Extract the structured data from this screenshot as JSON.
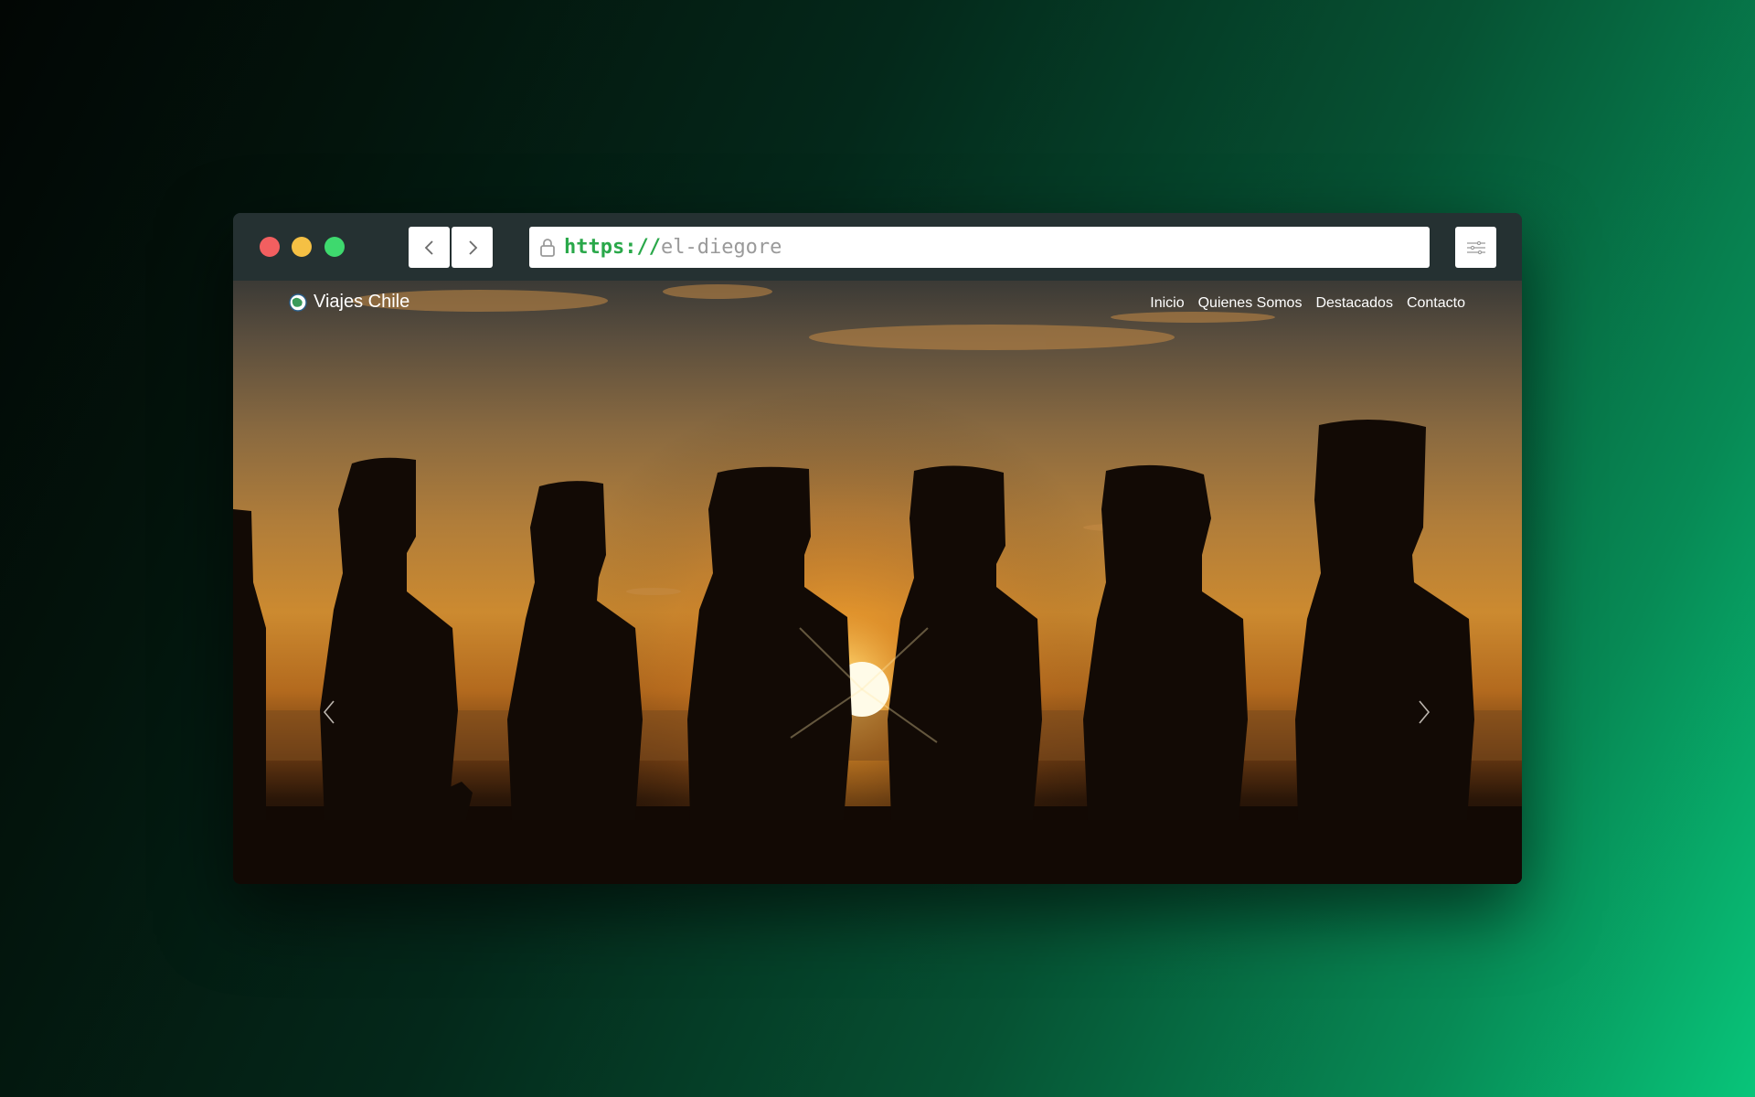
{
  "browser": {
    "url_scheme": "https://",
    "url_host": "el-diegore",
    "icons": {
      "back": "chevron-left-icon",
      "forward": "chevron-right-icon",
      "lock": "lock-icon",
      "menu": "sliders-icon"
    }
  },
  "site": {
    "brand": "Viajes Chile",
    "nav_links": [
      "Inicio",
      "Quienes Somos",
      "Destacados",
      "Contacto"
    ]
  },
  "hero": {
    "image_subject": "Moai statues silhouetted at sunset",
    "prev_icon": "chevron-left-icon",
    "next_icon": "chevron-right-icon"
  },
  "colors": {
    "traffic_red": "#f25f60",
    "traffic_yellow": "#f5c044",
    "traffic_green": "#3ed96e",
    "url_scheme": "#2aa84a",
    "url_host": "#9a9a9a"
  }
}
